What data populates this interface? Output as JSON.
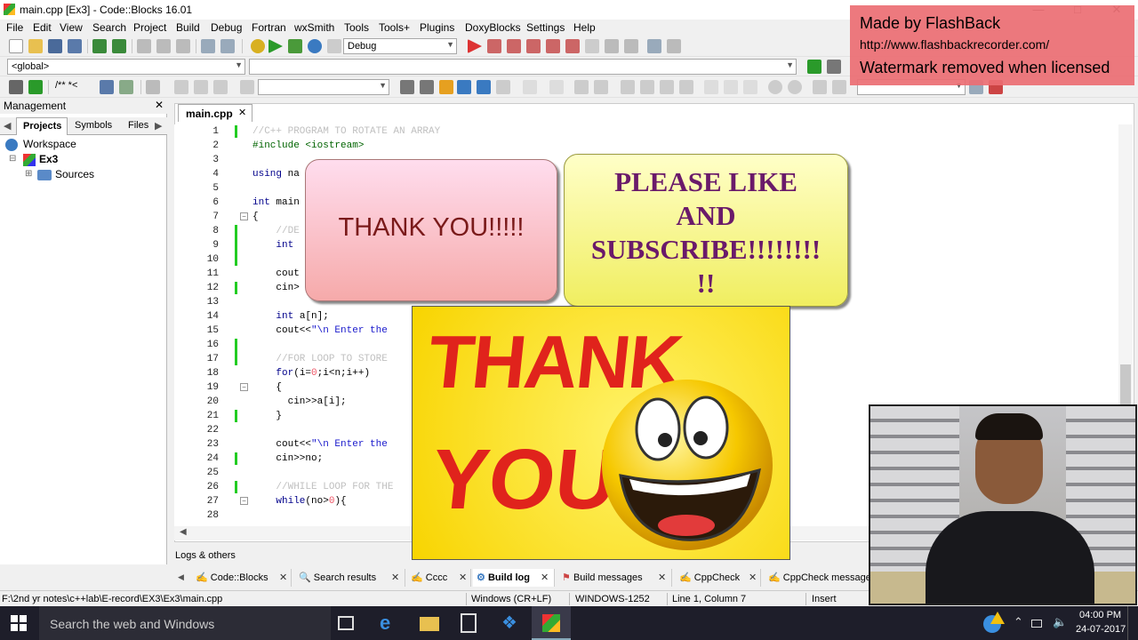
{
  "window": {
    "title": "main.cpp [Ex3] - Code::Blocks 16.01"
  },
  "menu": [
    "File",
    "Edit",
    "View",
    "Search",
    "Project",
    "Build",
    "Debug",
    "Fortran",
    "wxSmith",
    "Tools",
    "Tools+",
    "Plugins",
    "DoxyBlocks",
    "Settings",
    "Help"
  ],
  "toolbar": {
    "build_target": "Debug",
    "scope": "<global>",
    "search_combo": ""
  },
  "management": {
    "title": "Management",
    "tabs": [
      "Projects",
      "Symbols",
      "Files"
    ],
    "tree": {
      "workspace": "Workspace",
      "project": "Ex3",
      "sources": "Sources"
    }
  },
  "editor": {
    "tab": "main.cpp",
    "lines": [
      {
        "n": "1",
        "t": "//C++ PROGRAM TO ROTATE AN ARRAY"
      },
      {
        "n": "2",
        "t": "#include <iostream>"
      },
      {
        "n": "3",
        "t": ""
      },
      {
        "n": "4",
        "t": "using na"
      },
      {
        "n": "5",
        "t": ""
      },
      {
        "n": "6",
        "t": "int main"
      },
      {
        "n": "7",
        "t": "{"
      },
      {
        "n": "8",
        "t": "    //DE"
      },
      {
        "n": "9",
        "t": "    int "
      },
      {
        "n": "10",
        "t": ""
      },
      {
        "n": "11",
        "t": "    cout"
      },
      {
        "n": "12",
        "t": "    cin>"
      },
      {
        "n": "13",
        "t": ""
      },
      {
        "n": "14",
        "t": "    int a[n];"
      },
      {
        "n": "15",
        "t": "    cout<<\"\\n Enter the"
      },
      {
        "n": "16",
        "t": ""
      },
      {
        "n": "17",
        "t": "    //FOR LOOP TO STORE"
      },
      {
        "n": "18",
        "t": "    for(i=0;i<n;i++)"
      },
      {
        "n": "19",
        "t": "    {"
      },
      {
        "n": "20",
        "t": "      cin>>a[i];"
      },
      {
        "n": "21",
        "t": "    }"
      },
      {
        "n": "22",
        "t": ""
      },
      {
        "n": "23",
        "t": "    cout<<\"\\n Enter the"
      },
      {
        "n": "24",
        "t": "    cin>>no;"
      },
      {
        "n": "25",
        "t": ""
      },
      {
        "n": "26",
        "t": "    //WHILE LOOP FOR THE"
      },
      {
        "n": "27",
        "t": "    while(no>0){"
      },
      {
        "n": "28",
        "t": ""
      }
    ]
  },
  "logs": {
    "title": "Logs & others",
    "tabs": [
      "Code::Blocks",
      "Search results",
      "Cccc",
      "Build log",
      "Build messages",
      "CppCheck",
      "CppCheck messages"
    ]
  },
  "status": {
    "path": "F:\\2nd yr notes\\c++lab\\E-record\\EX3\\Ex3\\main.cpp",
    "eol": "Windows (CR+LF)",
    "encoding": "WINDOWS-1252",
    "position": "Line 1, Column 7",
    "mode": "Insert"
  },
  "overlays": {
    "watermark": [
      "Made by FlashBack",
      "http://www.flashbackrecorder.com/",
      "Watermark removed when licensed"
    ],
    "thank_you": "THANK YOU!!!!!",
    "subscribe": [
      "PLEASE LIKE",
      "AND",
      "SUBSCRIBE!!!!!!!!",
      "!!"
    ],
    "thanks_image": [
      "THANK",
      "YOU"
    ]
  },
  "taskbar": {
    "search": "Search the web and Windows",
    "time": "04:00 PM",
    "date": "24-07-2017"
  },
  "colors": {
    "accent": "#3e7fc1",
    "comment": "#c0c0c0",
    "keyword": "#00008b",
    "taskbar": "#1e1e2a"
  }
}
